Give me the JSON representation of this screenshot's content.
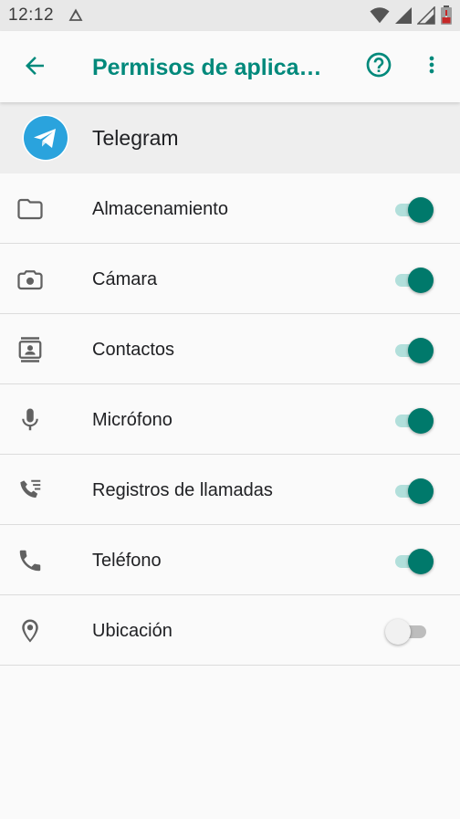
{
  "status_bar": {
    "time": "12:12",
    "left_icon": "drive-upload-icon",
    "right_icons": [
      "wifi-icon",
      "signal-icon",
      "signal-icon",
      "battery-low-icon"
    ]
  },
  "app_bar": {
    "back_icon": "arrow-back-icon",
    "title": "Permisos de aplica…",
    "help_icon": "help-circle-icon",
    "more_icon": "more-vert-icon"
  },
  "app": {
    "name": "Telegram",
    "logo_icon": "telegram-logo-icon"
  },
  "permissions": [
    {
      "label": "Almacenamiento",
      "icon": "folder-icon",
      "enabled": true
    },
    {
      "label": "Cámara",
      "icon": "camera-icon",
      "enabled": true
    },
    {
      "label": "Contactos",
      "icon": "contacts-icon",
      "enabled": true
    },
    {
      "label": "Micrófono",
      "icon": "microphone-icon",
      "enabled": true
    },
    {
      "label": "Registros de llamadas",
      "icon": "call-log-icon",
      "enabled": true
    },
    {
      "label": "Teléfono",
      "icon": "phone-icon",
      "enabled": true
    },
    {
      "label": "Ubicación",
      "icon": "location-icon",
      "enabled": false
    }
  ],
  "colors": {
    "accent": "#00897b",
    "switch_on_thumb": "#00796b",
    "switch_on_track": "#b2dfdb",
    "switch_off_thumb": "#f1f1f1",
    "switch_off_track": "#bdbdbd",
    "status_bar_bg": "#e8e8e8",
    "telegram_blue": "#2aa3dd"
  }
}
